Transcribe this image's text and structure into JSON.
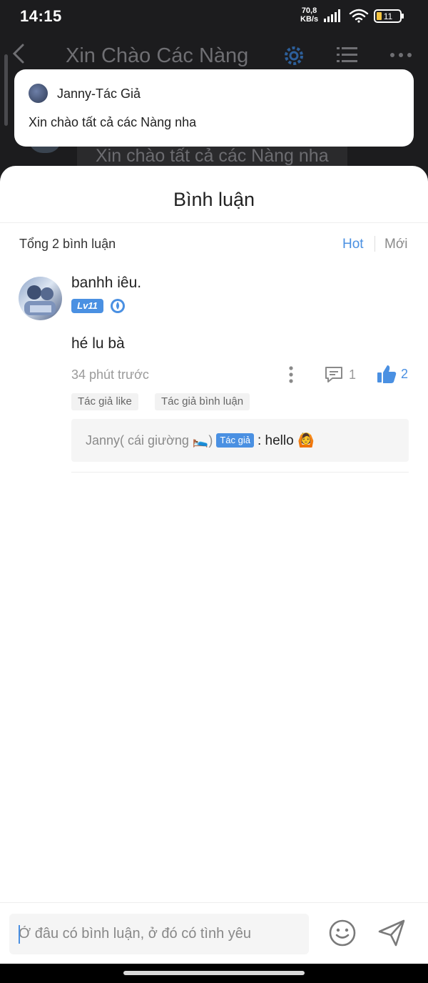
{
  "status_bar": {
    "time": "14:15",
    "net_speed_value": "70,8",
    "net_speed_unit": "KB/s",
    "battery": "11"
  },
  "reader": {
    "title": "Xin Chào Các Nàng",
    "bubble_text": "Xin chào tất cả các Nàng nha"
  },
  "notification": {
    "author": "Janny-Tác Giả",
    "message": "Xin chào tất cả các Nàng nha"
  },
  "comments_sheet": {
    "title": "Bình luận",
    "total_label": "Tổng 2 bình luận",
    "sort_options": [
      "Hot",
      "Mới"
    ],
    "comment": {
      "username": "banhh iêu.",
      "level": "Lv11",
      "text": "hé lu bà",
      "time": "34 phút trước",
      "reply_count": "1",
      "like_count": "2",
      "tags": [
        "Tác giả like",
        "Tác giả bình luận"
      ],
      "reply": {
        "user": "Janny( cái giường 🛌)",
        "badge": "Tác giả",
        "message": ": hello 🙆"
      }
    }
  },
  "input_bar": {
    "placeholder": "Ở đâu có bình luận, ở đó có tình yêu"
  },
  "colors": {
    "accent": "#4a90e2",
    "background_dim": "#1c1c1e"
  }
}
